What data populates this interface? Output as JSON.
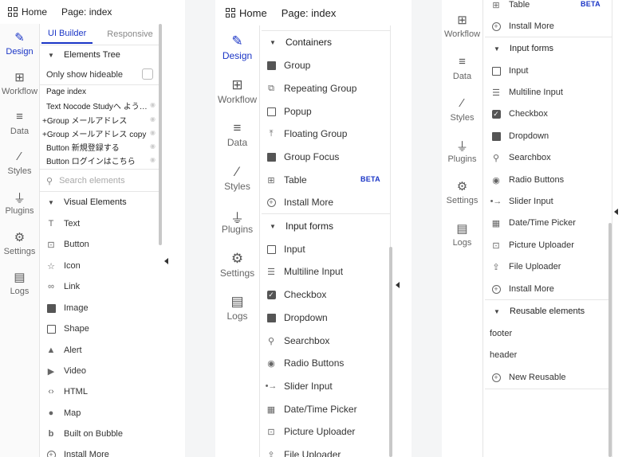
{
  "topbar": {
    "home": "Home",
    "page": "Page: index"
  },
  "rail": {
    "design": "Design",
    "workflow": "Workflow",
    "data": "Data",
    "styles": "Styles",
    "plugins": "Plugins",
    "settings": "Settings",
    "logs": "Logs"
  },
  "left": {
    "tabs": {
      "ui_builder": "UI Builder",
      "responsive": "Responsive"
    },
    "elements_tree": "Elements Tree",
    "only_show_hideable": "Only show hideable",
    "tree": [
      "Page index",
      "Text Nocode Studyへ よう…",
      "Group メールアドレス",
      "Group メールアドレス copy",
      "Button 新規登録する",
      "Button ログインはこちら"
    ],
    "search_placeholder": "Search elements",
    "visual_elements": "Visual Elements",
    "items": [
      "Text",
      "Button",
      "Icon",
      "Link",
      "Image",
      "Shape",
      "Alert",
      "Video",
      "HTML",
      "Map",
      "Built on Bubble",
      "Install More"
    ]
  },
  "middle": {
    "containers": "Containers",
    "container_items": [
      "Group",
      "Repeating Group",
      "Popup",
      "Floating Group",
      "Group Focus",
      "Table",
      "Install More"
    ],
    "beta": "BETA",
    "input_forms": "Input forms",
    "input_items": [
      "Input",
      "Multiline Input",
      "Checkbox",
      "Dropdown",
      "Searchbox",
      "Radio Buttons",
      "Slider Input",
      "Date/Time Picker",
      "Picture Uploader",
      "File Uploader"
    ]
  },
  "right": {
    "top_items": [
      "Table",
      "Install More"
    ],
    "beta": "BETA",
    "input_forms": "Input forms",
    "input_items": [
      "Input",
      "Multiline Input",
      "Checkbox",
      "Dropdown",
      "Searchbox",
      "Radio Buttons",
      "Slider Input",
      "Date/Time Picker",
      "Picture Uploader",
      "File Uploader",
      "Install More"
    ],
    "reusable": "Reusable elements",
    "reusable_items": [
      "footer",
      "header"
    ],
    "new_reusable": "New Reusable"
  },
  "colors": {
    "accent": "#1a35c6",
    "rail_bg": "#fafafa",
    "gap": "#f4f5f6"
  }
}
